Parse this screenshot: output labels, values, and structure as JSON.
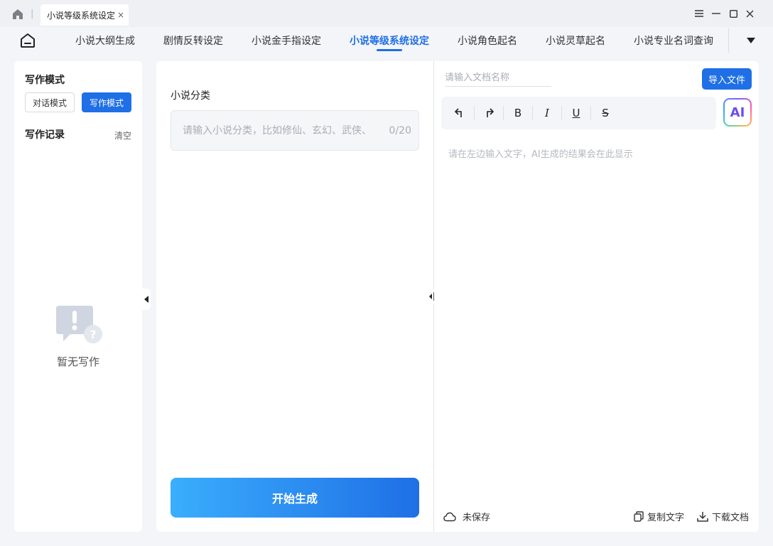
{
  "window": {
    "tab_title": "小说等级系统设定",
    "tab_close": "×"
  },
  "nav": {
    "items": [
      {
        "label": "小说大纲生成"
      },
      {
        "label": "剧情反转设定"
      },
      {
        "label": "小说金手指设定"
      },
      {
        "label": "小说等级系统设定",
        "active": true
      },
      {
        "label": "小说角色起名"
      },
      {
        "label": "小说灵草起名"
      },
      {
        "label": "小说专业名词查询"
      }
    ]
  },
  "sidebar": {
    "mode_title": "写作模式",
    "mode_dialog": "对话模式",
    "mode_writing": "写作模式",
    "records_title": "写作记录",
    "clear_label": "清空",
    "empty_text": "暂无写作"
  },
  "form": {
    "category_label": "小说分类",
    "category_placeholder": "请输入小说分类，比如修仙、玄幻、武侠、",
    "category_count": "0/20",
    "generate_label": "开始生成"
  },
  "editor": {
    "doc_name_placeholder": "请输入文档名称",
    "import_label": "导入文件",
    "ai_label": "AI",
    "toolbar": {
      "bold": "B",
      "italic": "I",
      "underline": "U",
      "strike": "S"
    },
    "hint": "请在左边输入文字，AI生成的结果会在此显示",
    "save_status": "未保存",
    "copy_label": "复制文字",
    "download_label": "下载文档"
  },
  "colors": {
    "accent": "#1f6fe6",
    "background": "#f3f5f9"
  }
}
